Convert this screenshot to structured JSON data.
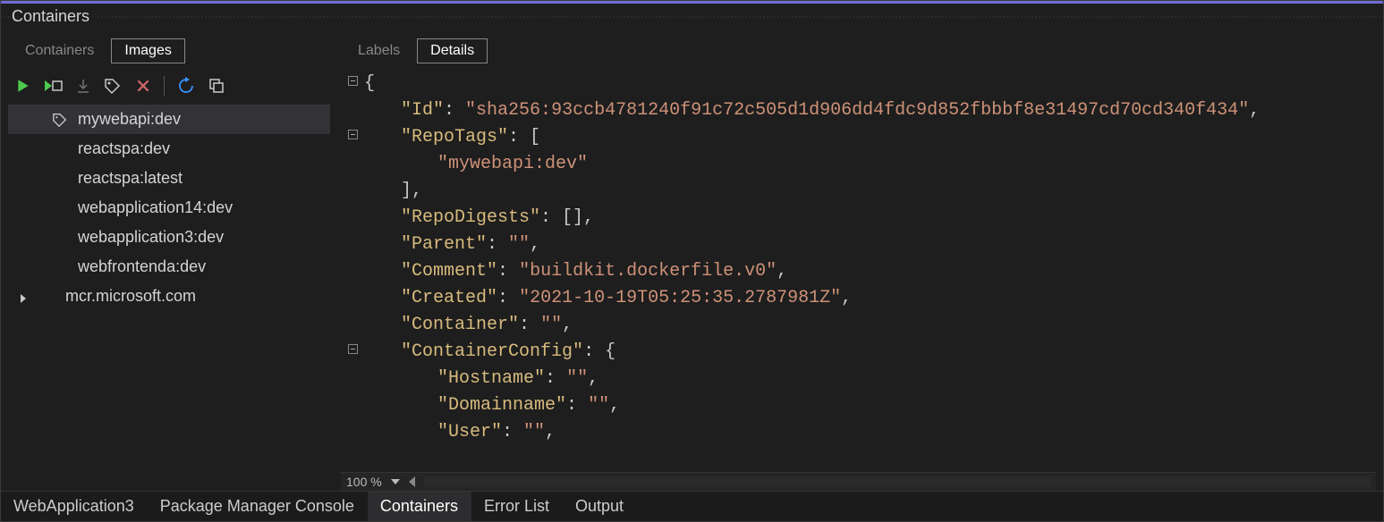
{
  "panel": {
    "title": "Containers"
  },
  "left": {
    "tabs": {
      "containers": "Containers",
      "images": "Images",
      "active": "images"
    },
    "toolbar": {
      "run": "run",
      "run_new": "run_new",
      "pull": "pull",
      "tag": "tag",
      "delete": "delete",
      "refresh": "refresh",
      "copy": "copy"
    },
    "images": [
      {
        "name": "mywebapi:dev",
        "selected": true,
        "tagged": true
      },
      {
        "name": "reactspa:dev"
      },
      {
        "name": "reactspa:latest"
      },
      {
        "name": "webapplication14:dev"
      },
      {
        "name": "webapplication3:dev"
      },
      {
        "name": "webfrontenda:dev"
      },
      {
        "name": "mcr.microsoft.com",
        "expandable": true
      }
    ]
  },
  "right": {
    "tabs": {
      "labels": "Labels",
      "details": "Details",
      "active": "details"
    },
    "zoom": "100 %"
  },
  "details_json": {
    "Id": "sha256:93ccb4781240f91c72c505d1d906dd4fdc9d852fbbbf8e31497cd70cd340f434",
    "RepoTags": [
      "mywebapi:dev"
    ],
    "RepoDigests": [],
    "Parent": "",
    "Comment": "buildkit.dockerfile.v0",
    "Created": "2021-10-19T05:25:35.2787981Z",
    "Container": "",
    "ContainerConfig": {
      "Hostname": "",
      "Domainname": "",
      "User": ""
    }
  },
  "bottom_tabs": [
    {
      "label": "WebApplication3"
    },
    {
      "label": "Package Manager Console"
    },
    {
      "label": "Containers",
      "active": true
    },
    {
      "label": "Error List"
    },
    {
      "label": "Output"
    }
  ]
}
